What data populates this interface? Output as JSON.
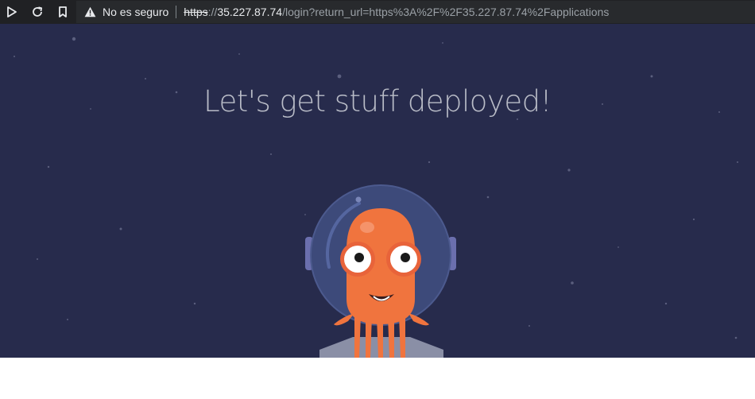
{
  "browser": {
    "security_label": "No es seguro",
    "url_scheme": "https",
    "url_separator": "://",
    "url_host": "35.227.87.74",
    "url_rest": "/login?return_url=https%3A%2F%2F35.227.87.74%2Fapplications",
    "icons": {
      "play": "play-icon",
      "reload": "reload-icon",
      "bookmark": "bookmark-icon",
      "warning": "warning-icon"
    }
  },
  "page": {
    "title": "Let's get stuff deployed!",
    "background_color": "#272b4c",
    "mascot_color": "#f0743e"
  }
}
